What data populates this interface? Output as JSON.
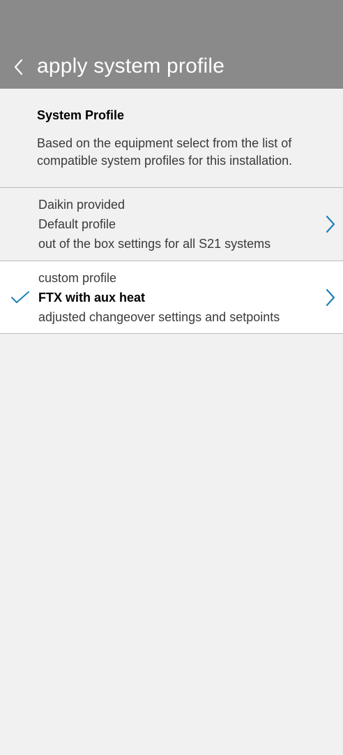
{
  "header": {
    "title": "apply system profile",
    "back_icon": "chevron-left-icon"
  },
  "intro": {
    "title": "System  Profile",
    "description": "Based on the equipment select from the list of compatible system profiles for this installation."
  },
  "profiles": [
    {
      "category": "Daikin provided",
      "name": "Default profile",
      "description": "out of the box settings for all S21 systems",
      "selected": false
    },
    {
      "category": "custom profile",
      "name": "FTX with aux heat",
      "description": "adjusted changeover settings and setpoints",
      "selected": true
    }
  ],
  "colors": {
    "header_bg": "#8a8a8a",
    "page_bg": "#f1f1f1",
    "selected_row_bg": "#ffffff",
    "accent": "#1f7fb8"
  }
}
